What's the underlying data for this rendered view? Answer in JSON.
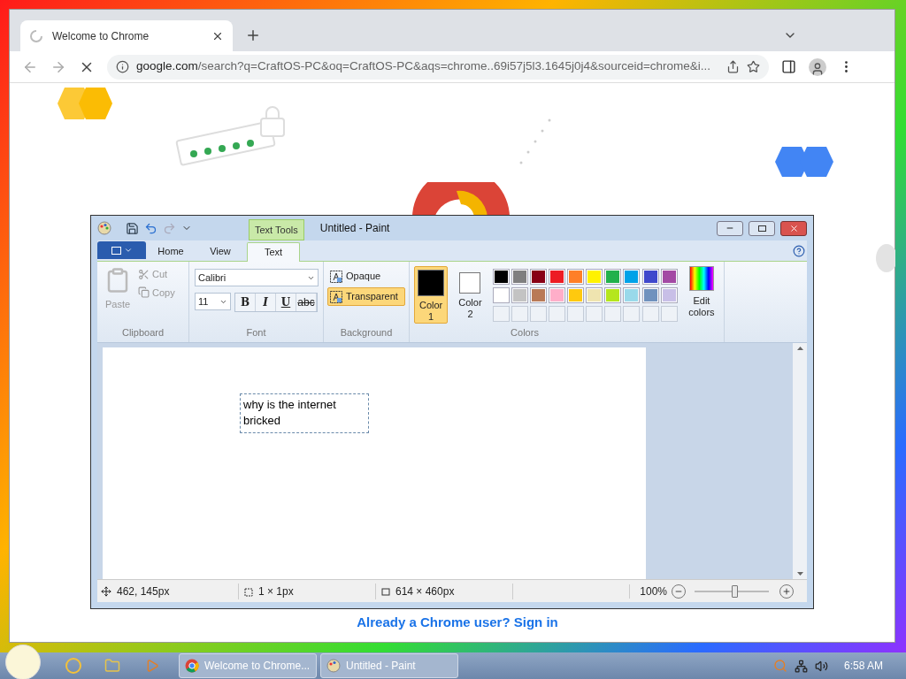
{
  "browser": {
    "tab": {
      "title": "Welcome to Chrome",
      "loading": true
    },
    "url": {
      "host": "google.com",
      "path": "/search?q=CraftOS-PC&oq=CraftOS-PC&aqs=chrome..69i57j5l3.1645j0j4&sourceid=chrome&i..."
    },
    "page": {
      "sign_in": "Already a Chrome user? Sign in"
    }
  },
  "paint": {
    "title": "Untitled - Paint",
    "context_tab": "Text Tools",
    "tabs": [
      {
        "label": "Home",
        "selected": false
      },
      {
        "label": "View",
        "selected": false
      },
      {
        "label": "Text",
        "selected": true
      }
    ],
    "clipboard": {
      "paste": "Paste",
      "cut": "Cut",
      "copy": "Copy",
      "label": "Clipboard"
    },
    "font": {
      "name": "Calibri",
      "size": "11",
      "styles": [
        {
          "label": "B",
          "kind": "bold"
        },
        {
          "label": "I",
          "kind": "italic"
        },
        {
          "label": "U",
          "kind": "underline"
        },
        {
          "label": "abc",
          "kind": "strike"
        }
      ],
      "label": "Font"
    },
    "background": {
      "options": [
        {
          "label": "Opaque",
          "selected": false
        },
        {
          "label": "Transparent",
          "selected": true
        }
      ],
      "label": "Background"
    },
    "colors": {
      "slots": [
        {
          "label": "Color 1",
          "color": "#000000",
          "selected": true
        },
        {
          "label": "Color 2",
          "color": "#ffffff",
          "selected": false
        }
      ],
      "palette": [
        {
          "color": "#000000"
        },
        {
          "color": "#7f7f7f"
        },
        {
          "color": "#880015"
        },
        {
          "color": "#ed1c24"
        },
        {
          "color": "#ff7f27"
        },
        {
          "color": "#fff200"
        },
        {
          "color": "#22b14c"
        },
        {
          "color": "#00a2e8"
        },
        {
          "color": "#3f48cc"
        },
        {
          "color": "#a349a4"
        },
        {
          "color": "#ffffff"
        },
        {
          "color": "#c3c3c3"
        },
        {
          "color": "#b97a57"
        },
        {
          "color": "#ffaec9"
        },
        {
          "color": "#ffc90e"
        },
        {
          "color": "#efe4b0"
        },
        {
          "color": "#b5e61d"
        },
        {
          "color": "#99d9ea"
        },
        {
          "color": "#7092be"
        },
        {
          "color": "#c8bfe7"
        }
      ],
      "edit": "Edit colors",
      "label": "Colors"
    },
    "canvas_text": "why is the internet bricked",
    "status": {
      "position": "462, 145px",
      "selection": "1 × 1px",
      "size": "614 × 460px",
      "zoom": "100%",
      "level": 0.55
    }
  },
  "taskbar": {
    "tasks": [
      {
        "label": "Welcome to Chrome...",
        "kind": "chrome"
      },
      {
        "label": "Untitled - Paint",
        "kind": "paint"
      }
    ],
    "clock": "6:58 AM"
  }
}
